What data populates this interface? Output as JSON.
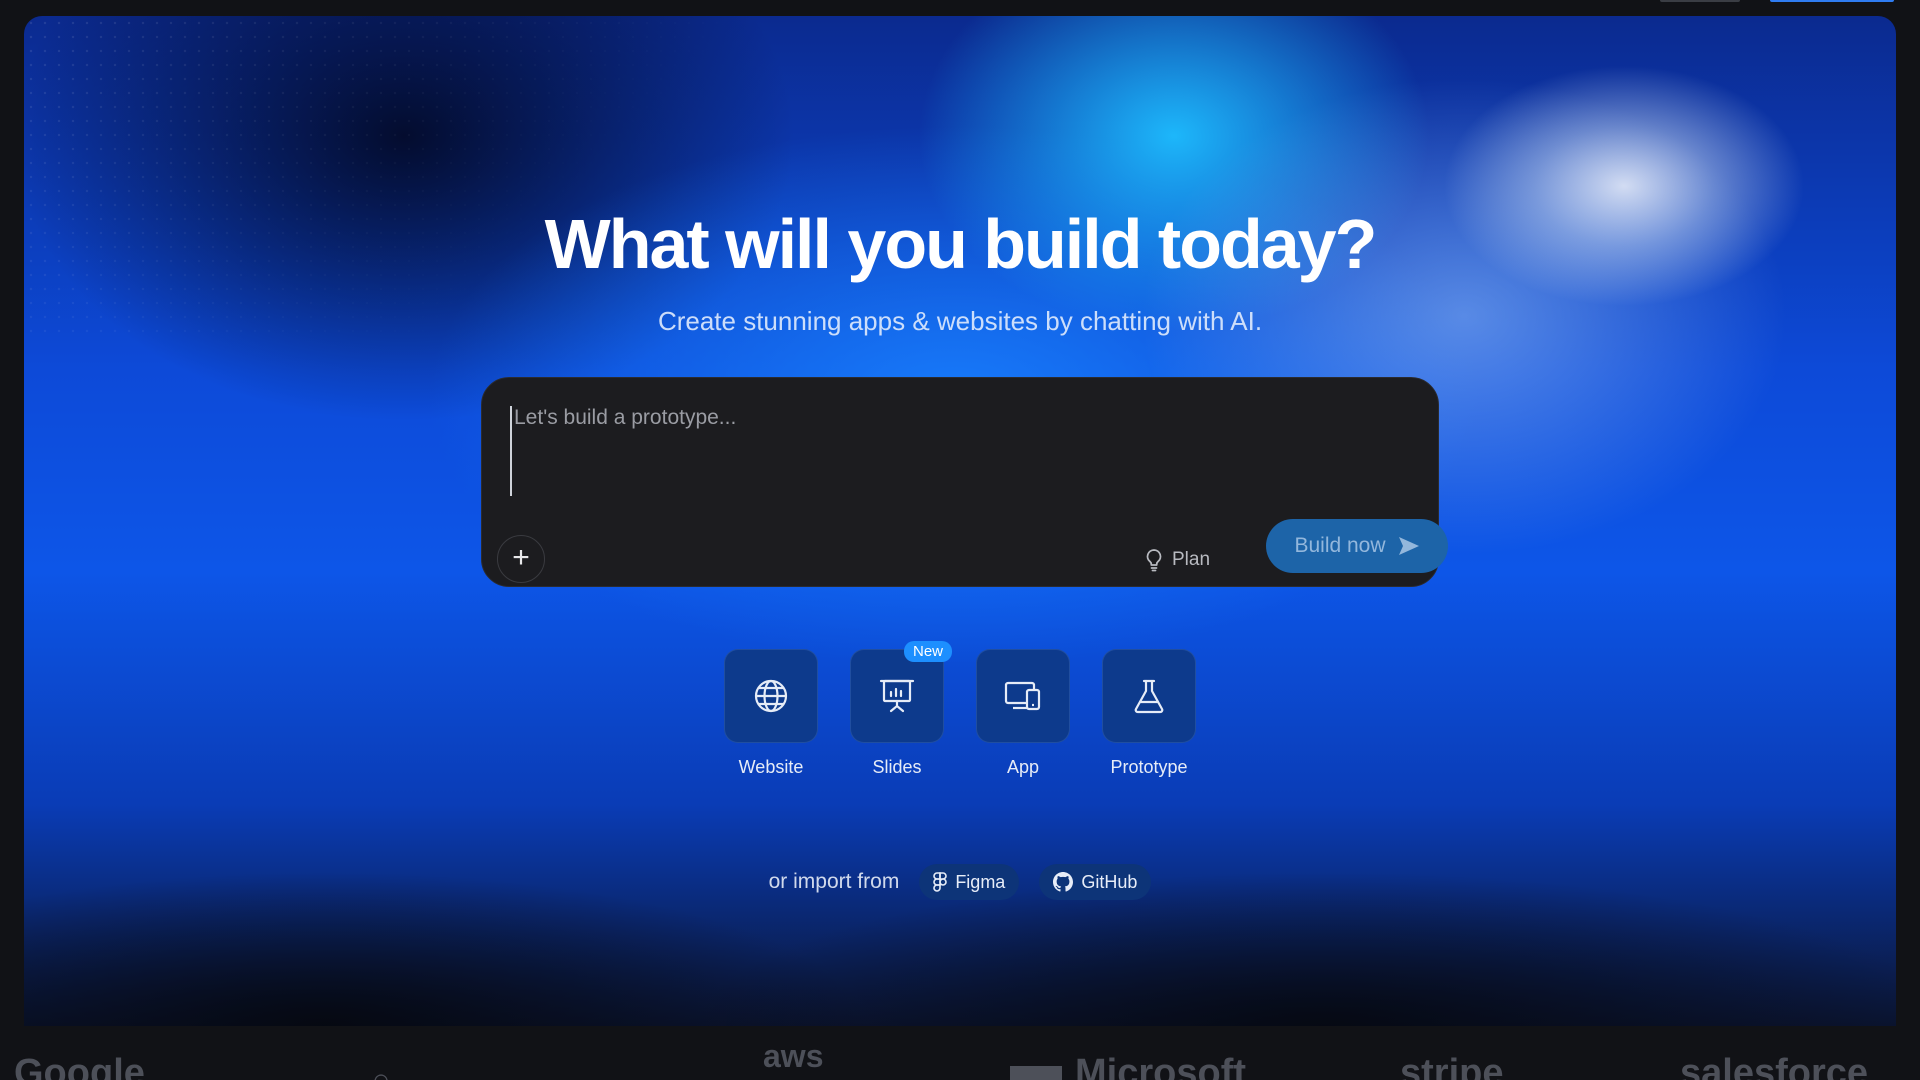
{
  "hero": {
    "title": "What will you build today?",
    "subtitle": "Create stunning apps & websites by chatting with AI."
  },
  "prompt": {
    "placeholder": "Let's build a prototype...",
    "add_label": "+",
    "plan_label": "Plan",
    "build_label": "Build now"
  },
  "tiles": [
    {
      "label": "Website",
      "icon": "globe-icon"
    },
    {
      "label": "Slides",
      "icon": "presentation-icon",
      "badge": "New"
    },
    {
      "label": "App",
      "icon": "devices-icon"
    },
    {
      "label": "Prototype",
      "icon": "flask-icon"
    }
  ],
  "import": {
    "label": "or import from",
    "figma": "Figma",
    "github": "GitHub"
  },
  "logos": {
    "google": "Google",
    "aws": "aws",
    "microsoft": "Microsoft",
    "stripe": "stripe",
    "salesforce": "salesforce"
  },
  "colors": {
    "accent": "#1d64a8",
    "badge": "#1d8fff",
    "tile": "#0d3a8c",
    "panel": "#1c1c1f"
  }
}
